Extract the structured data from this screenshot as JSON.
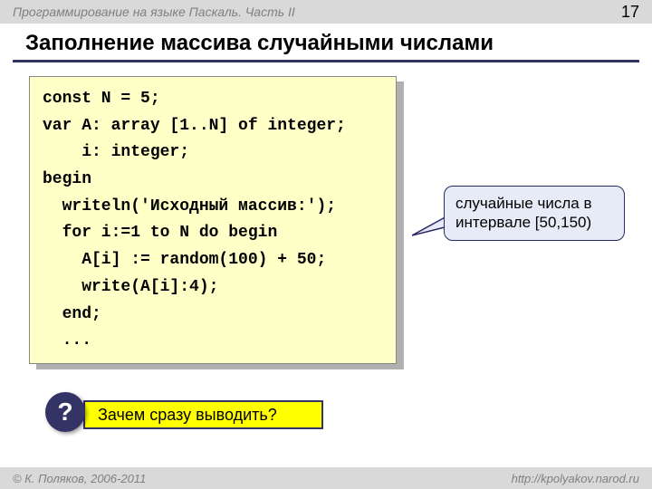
{
  "topbar": {
    "title": "Программирование на языке Паскаль. Часть II",
    "page": "17"
  },
  "heading": "Заполнение массива случайными числами",
  "code": {
    "l1": "const N = 5;",
    "l2": "var A: array [1..N] of integer;",
    "l3": "    i: integer;",
    "l4": "begin",
    "l5": "  writeln('Исходный массив:');",
    "l6": "  for i:=1 to N do begin",
    "l7": "    A[i] := random(100) + 50;",
    "l8": "    write(A[i]:4);",
    "l9": "  end;",
    "l10": "  ..."
  },
  "callout": "случайные числа в интервале [50,150)",
  "question": {
    "badge": "?",
    "text": "Зачем сразу выводить?"
  },
  "footer": {
    "left": "© К. Поляков, 2006-2011",
    "right": "http://kpolyakov.narod.ru"
  }
}
